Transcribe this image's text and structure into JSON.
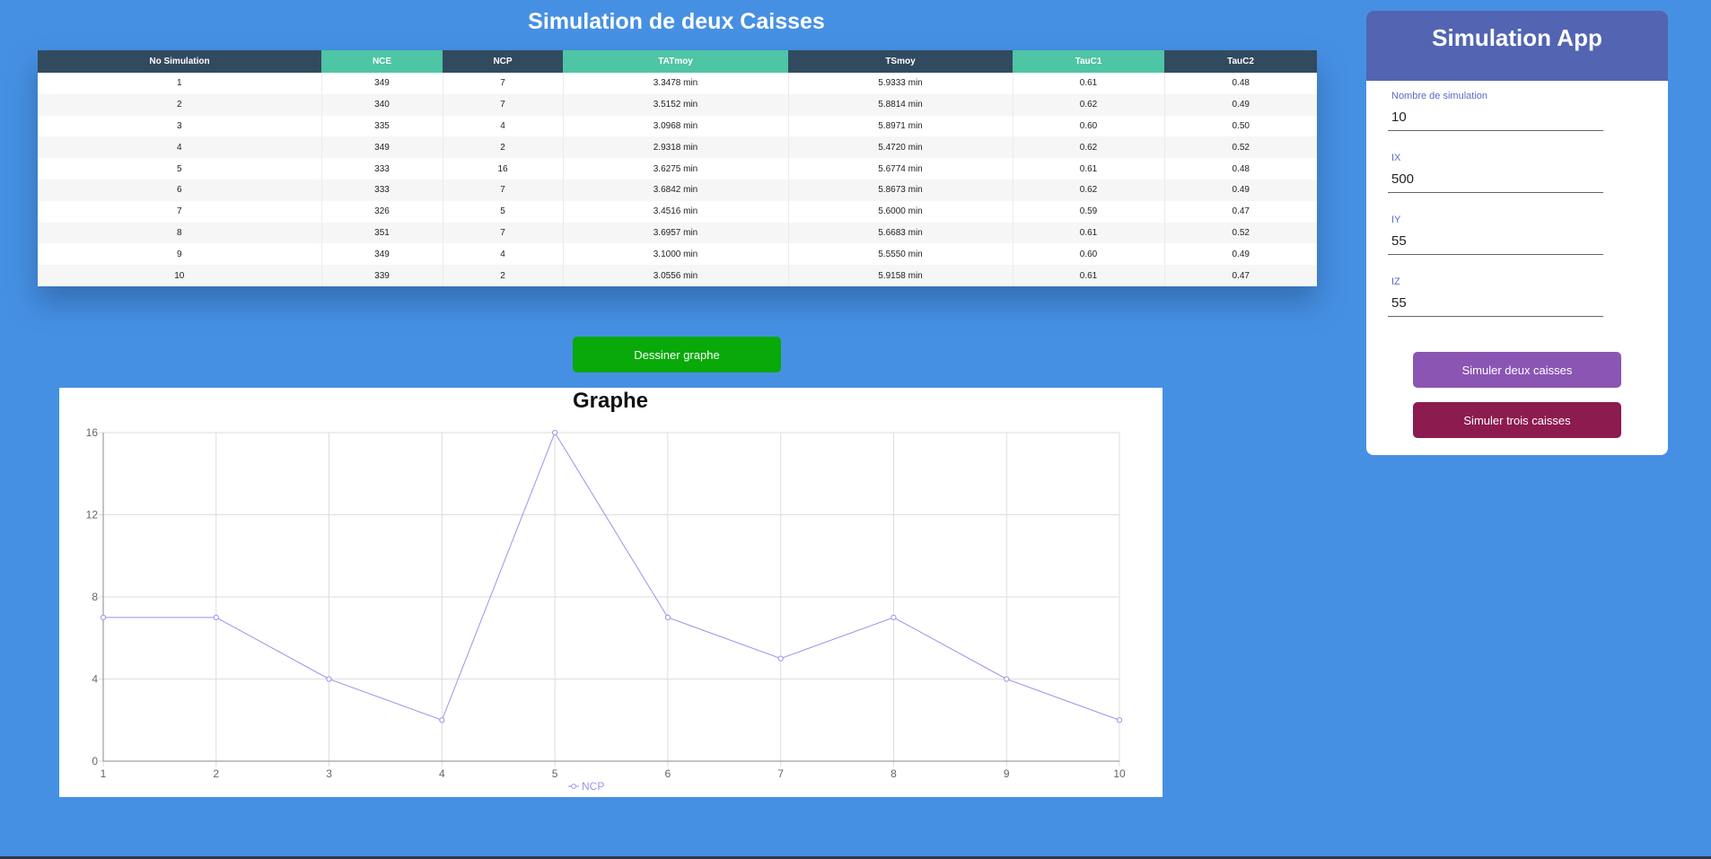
{
  "page": {
    "title": "Simulation de deux Caisses",
    "draw_button": "Dessiner graphe"
  },
  "table": {
    "headers": [
      "No Simulation",
      "NCE",
      "NCP",
      "TATmoy",
      "TSmoy",
      "TauC1",
      "TauC2"
    ],
    "header_colors": [
      "#324a5f",
      "#4ec5a4",
      "#324a5f",
      "#4ec5a4",
      "#324a5f",
      "#4ec5a4",
      "#324a5f"
    ],
    "rows": [
      [
        "1",
        "349",
        "7",
        "3.3478 min",
        "5.9333 min",
        "0.61",
        "0.48"
      ],
      [
        "2",
        "340",
        "7",
        "3.5152 min",
        "5.8814 min",
        "0.62",
        "0.49"
      ],
      [
        "3",
        "335",
        "4",
        "3.0968 min",
        "5.8971 min",
        "0.60",
        "0.50"
      ],
      [
        "4",
        "349",
        "2",
        "2.9318 min",
        "5.4720 min",
        "0.62",
        "0.52"
      ],
      [
        "5",
        "333",
        "16",
        "3.6275 min",
        "5.6774 min",
        "0.61",
        "0.48"
      ],
      [
        "6",
        "333",
        "7",
        "3.6842 min",
        "5.8673 min",
        "0.62",
        "0.49"
      ],
      [
        "7",
        "326",
        "5",
        "3.4516 min",
        "5.6000 min",
        "0.59",
        "0.47"
      ],
      [
        "8",
        "351",
        "7",
        "3.6957 min",
        "5.6683 min",
        "0.61",
        "0.52"
      ],
      [
        "9",
        "349",
        "4",
        "3.1000 min",
        "5.5550 min",
        "0.60",
        "0.49"
      ],
      [
        "10",
        "339",
        "2",
        "3.0556 min",
        "5.9158 min",
        "0.61",
        "0.47"
      ]
    ]
  },
  "chart": {
    "title": "Graphe"
  },
  "chart_data": {
    "type": "line",
    "title": "Graphe",
    "xlabel": "",
    "ylabel": "",
    "x": [
      1,
      2,
      3,
      4,
      5,
      6,
      7,
      8,
      9,
      10
    ],
    "series": [
      {
        "name": "NCP",
        "values": [
          7,
          7,
          4,
          2,
          16,
          7,
          5,
          7,
          4,
          2
        ]
      }
    ],
    "xlim": [
      1,
      10
    ],
    "ylim": [
      0,
      16
    ],
    "yticks": [
      0,
      4,
      8,
      12,
      16
    ],
    "grid": true,
    "legend": "bottom",
    "line_color": "#9b93e8"
  },
  "sidebar": {
    "title": "Simulation App",
    "fields": [
      {
        "label": "Nombre de simulation",
        "value": "10"
      },
      {
        "label": "IX",
        "value": "500"
      },
      {
        "label": "IY",
        "value": "55"
      },
      {
        "label": "IZ",
        "value": "55"
      }
    ],
    "btn_two": "Simuler deux caisses",
    "btn_three": "Simuler trois caisses"
  }
}
